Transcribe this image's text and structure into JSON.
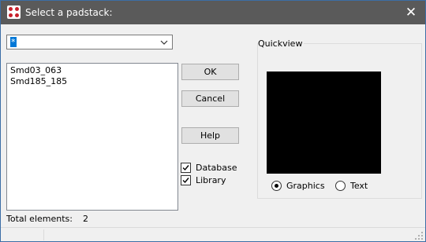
{
  "window": {
    "title": "Select a padstack:",
    "close_glyph": "✕",
    "icon": "padstack-app-icon"
  },
  "filter": {
    "value": "*",
    "arrow_icon": "chevron-down-icon"
  },
  "list": {
    "items": [
      "Smd03_063",
      "Smd185_185"
    ]
  },
  "buttons": {
    "ok": "OK",
    "cancel": "Cancel",
    "help": "Help"
  },
  "options": {
    "database": {
      "label": "Database",
      "checked": true
    },
    "library": {
      "label": "Library",
      "checked": true
    }
  },
  "footer": {
    "total_label": "Total elements:",
    "total_value": "2"
  },
  "quickview": {
    "label": "Quickview",
    "mode_graphics": {
      "label": "Graphics",
      "selected": true
    },
    "mode_text": {
      "label": "Text",
      "selected": false
    }
  },
  "colors": {
    "titlebar": "#5a5a5a",
    "selection": "#0078d7",
    "accent_red": "#c8202a",
    "preview_bg": "#000000"
  }
}
